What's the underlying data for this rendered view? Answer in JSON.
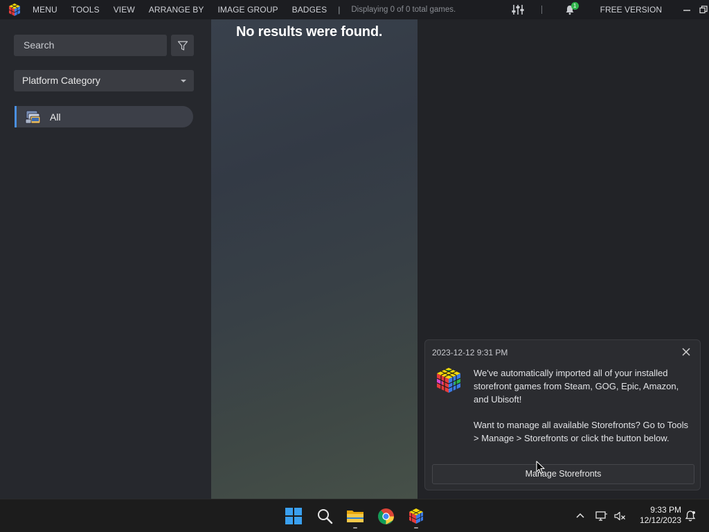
{
  "topbar": {
    "menu": [
      "MENU",
      "TOOLS",
      "VIEW",
      "ARRANGE BY",
      "IMAGE GROUP",
      "BADGES"
    ],
    "separator": "|",
    "status": "Displaying 0 of 0 total games.",
    "notification_count": "1",
    "edition": "FREE VERSION"
  },
  "sidebar": {
    "search_placeholder": "Search",
    "platform_filter": "Platform Category",
    "items": [
      {
        "label": "All"
      }
    ]
  },
  "main": {
    "empty_message": "No results were found."
  },
  "notification": {
    "timestamp": "2023-12-12 9:31 PM",
    "paragraph1": "We've automatically imported all of your installed storefront games from Steam, GOG, Epic, Amazon, and Ubisoft!",
    "paragraph2": "Want to manage all available Storefronts? Go to Tools > Manage > Storefronts or click the button below.",
    "button": "Manage Storefronts"
  },
  "taskbar": {
    "apps": [
      "windows-start",
      "search",
      "file-explorer",
      "chrome",
      "launchbox"
    ],
    "time": "9:33 PM",
    "date": "12/12/2023"
  },
  "colors": {
    "accent": "#4a8fe0",
    "background": "#1f2024",
    "sidebar": "#26282d"
  }
}
